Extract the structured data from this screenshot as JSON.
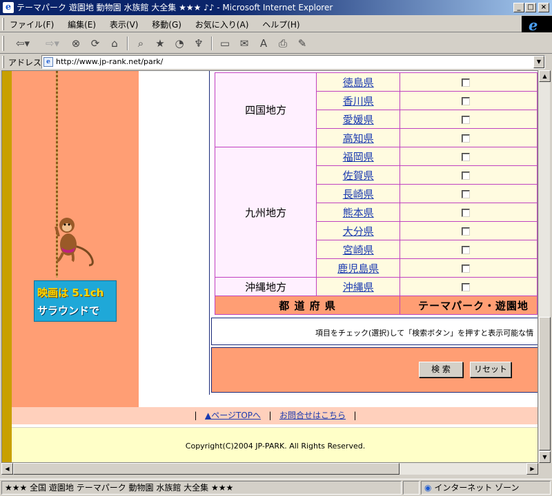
{
  "window": {
    "title": "テーマパーク 遊園地 動物園 水族館 大全集 ★★★ ♪♪ - Microsoft Internet Explorer"
  },
  "menu": [
    "ファイル(F)",
    "編集(E)",
    "表示(V)",
    "移動(G)",
    "お気に入り(A)",
    "ヘルプ(H)"
  ],
  "address": {
    "label": "アドレス",
    "url": "http://www.jp-rank.net/park/"
  },
  "banner": {
    "line1": "映画は 5.1ch",
    "line2": "サラウンドで"
  },
  "regions": {
    "shikoku": "四国地方",
    "kyushu": "九州地方",
    "okinawa": "沖縄地方"
  },
  "prefectures": {
    "tokushima": "徳島県",
    "kagawa": "香川県",
    "ehime": "愛媛県",
    "kochi": "高知県",
    "fukuoka": "福岡県",
    "saga": "佐賀県",
    "nagasaki": "長崎県",
    "kumamoto": "熊本県",
    "oita": "大分県",
    "miyazaki": "宮崎県",
    "kagoshima": "鹿児島県",
    "okinawa": "沖縄県"
  },
  "table_footer": {
    "col1": "都 道 府 県",
    "col2": "テーマパーク・遊園地"
  },
  "note": "項目をチェック(選択)して「検索ボタン」を押すと表示可能な情",
  "buttons": {
    "search": "検 索",
    "reset": "リセット"
  },
  "nav": {
    "sep": "|",
    "page_top": "▲ページTOPへ",
    "contact": "お問合せはこちら"
  },
  "copyright": "Copyright(C)2004 JP-PARK. All Rights Reserved.",
  "status": {
    "text": "★★★ 全国 遊園地 テーマパーク 動物園 水族館 大全集 ★★★",
    "zone": "インターネット ゾーン"
  },
  "colors": {
    "title_bar": "#0a246a",
    "side_panel": "#ff9e74",
    "table_border": "#c040c0",
    "footer_bg": "#ffffc8"
  }
}
